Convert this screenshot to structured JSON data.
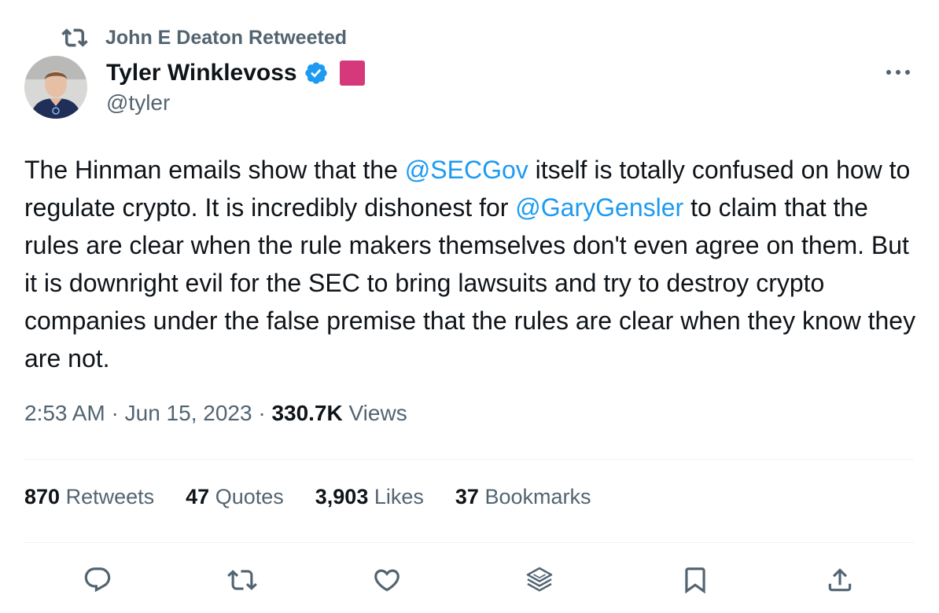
{
  "retweet": {
    "icon": "retweet-icon",
    "text": "John E Deaton Retweeted"
  },
  "author": {
    "name": "Tyler Winklevoss",
    "handle": "@tyler",
    "avatar_icon": "avatar-photo",
    "verified_icon": "verified-badge-icon",
    "affiliate_color": "#d6387c"
  },
  "tweet": {
    "text_segments": [
      {
        "text": "The Hinman emails show that the ",
        "mention": false
      },
      {
        "text": "@SECGov",
        "mention": true
      },
      {
        "text": " itself is totally confused on how to regulate crypto. It is incredibly dishonest for ",
        "mention": false
      },
      {
        "text": "@GaryGensler",
        "mention": true
      },
      {
        "text": " to claim that the rules are clear when the rule makers themselves don't even agree on them. But it is downright evil for the SEC to bring lawsuits and try to destroy crypto companies under the false premise that the rules are clear when they know they are not.",
        "mention": false
      }
    ]
  },
  "meta": {
    "time": "2:53 AM",
    "separator": "·",
    "date": "Jun 15, 2023",
    "views_count": "330.7K",
    "views_label": "Views"
  },
  "stats": {
    "retweets": {
      "count": "870",
      "label": "Retweets"
    },
    "quotes": {
      "count": "47",
      "label": "Quotes"
    },
    "likes": {
      "count": "3,903",
      "label": "Likes"
    },
    "bookmarks": {
      "count": "37",
      "label": "Bookmarks"
    }
  },
  "actions": [
    "reply-icon",
    "retweet-icon",
    "like-icon",
    "stack-icon",
    "bookmark-icon",
    "share-icon"
  ],
  "colors": {
    "text": "#0f1419",
    "secondary": "#536471",
    "link": "#1d9bf0",
    "divider": "#eff3f4"
  }
}
